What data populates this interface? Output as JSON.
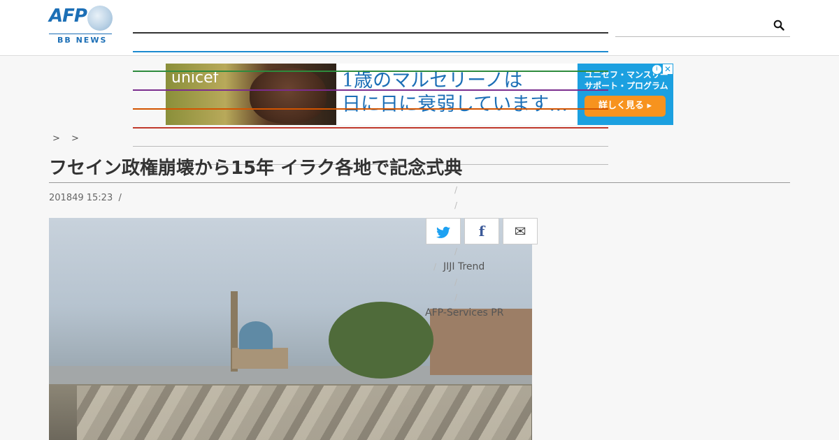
{
  "header": {
    "logo_text": "AFP",
    "logo_sub": "BB NEWS",
    "search_placeholder": ""
  },
  "ad": {
    "brand": "unicef",
    "headline_1": "1歳のマルセリーノは",
    "headline_2": "日に日に衰弱しています…",
    "side_1": "ユニセフ・マンスリー",
    "side_2": "サポート・プログラム",
    "cta": "詳しく見る ▸"
  },
  "breadcrumb": "> >",
  "article": {
    "title": "フセイン政権崩壊から15年 イラク各地で記念式典",
    "date": "201849 15:23",
    "date_sep": "/"
  },
  "share": {
    "twitter": "t",
    "facebook": "f",
    "mail": "✉"
  },
  "sidebar": {
    "links": [
      "JIJI Trend",
      "AFP-Services PR"
    ]
  },
  "colors": {
    "afp_blue": "#1c6fb6",
    "menu_lines": [
      "#333333",
      "#1c8ad0",
      "#2e8b3d",
      "#7b2d8e",
      "#d35400",
      "#c0392b"
    ]
  },
  "icons": [
    "search-icon",
    "twitter-icon",
    "facebook-icon",
    "mail-icon",
    "adchoices-icon",
    "close-icon"
  ]
}
